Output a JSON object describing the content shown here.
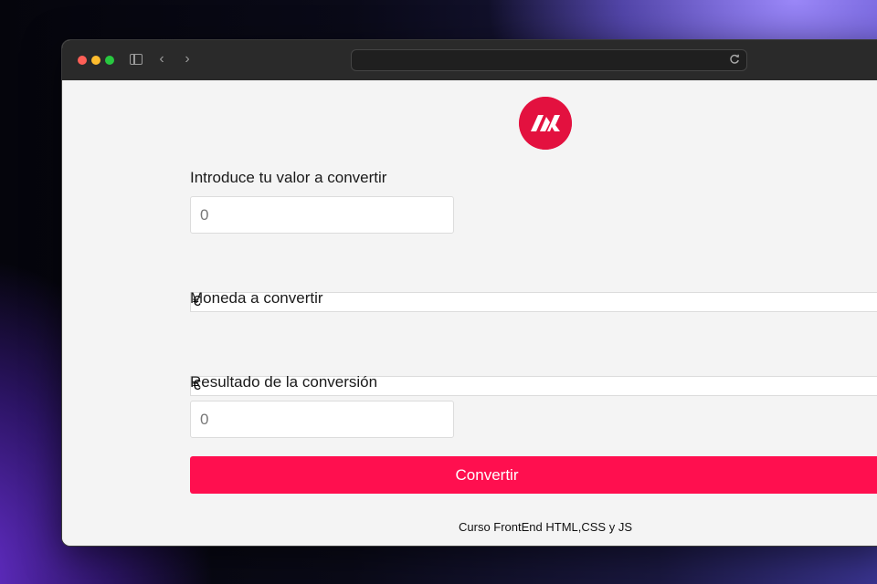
{
  "browser": {
    "address_value": "",
    "icons": {
      "sidebar": "sidebar-icon",
      "back": "chevron-left-icon",
      "forward": "chevron-right-icon",
      "reload": "reload-icon"
    },
    "back_glyph": "‹",
    "forward_glyph": "›"
  },
  "colors": {
    "accent": "#ff0f4f",
    "logo": "#e3113f",
    "page_bg": "#f4f4f4"
  },
  "form": {
    "input_label": "Introduce tu valor a convertir",
    "input_placeholder": "0",
    "from_currency_selected": "€",
    "target_label": "Moneda a convertir",
    "to_currency_selected": "€",
    "result_label": "Resultado de la conversión",
    "result_placeholder": "0",
    "convert_label": "Convertir"
  },
  "footer": {
    "text": "Curso FrontEnd HTML,CSS y JS"
  }
}
